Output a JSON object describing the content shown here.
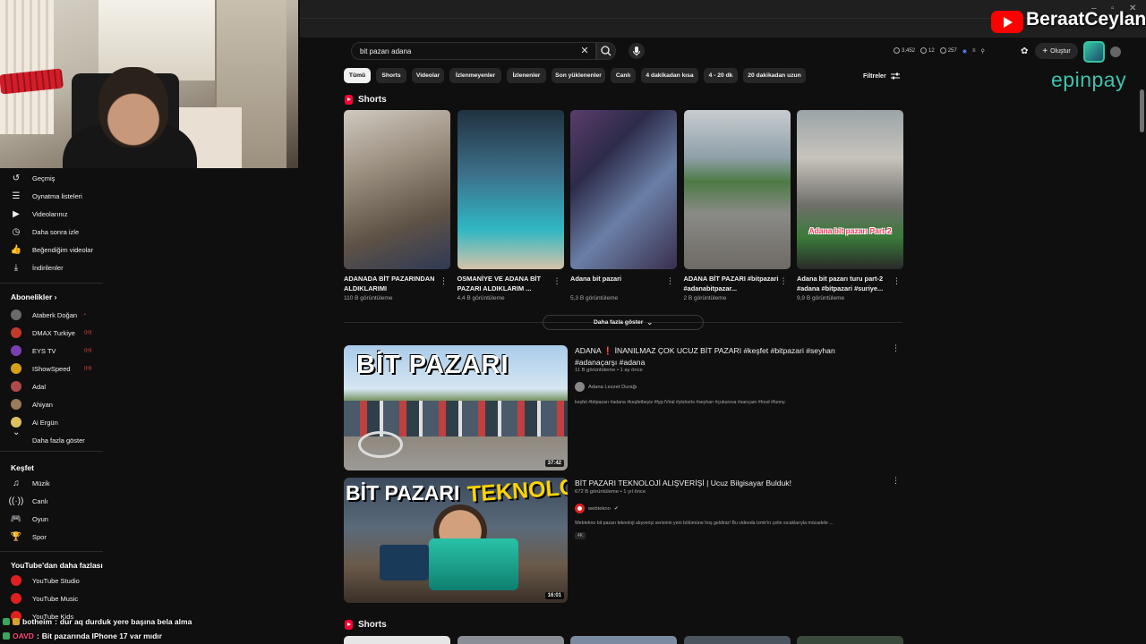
{
  "overlay": {
    "channel_name": "BeraatCeylan",
    "sponsor": "epinpay"
  },
  "search": {
    "query": "bit pazarı adana"
  },
  "header": {
    "stats": [
      "3,452",
      "12",
      "257"
    ],
    "create_label": "Oluştur"
  },
  "sidebar": {
    "you_items": [
      {
        "label": "Geçmiş",
        "icon": "history-icon"
      },
      {
        "label": "Oynatma listeleri",
        "icon": "playlist-icon"
      },
      {
        "label": "Videolarınız",
        "icon": "video-icon"
      },
      {
        "label": "Daha sonra izle",
        "icon": "clock-icon"
      },
      {
        "label": "Beğendiğim videolar",
        "icon": "thumbs-up-icon"
      },
      {
        "label": "İndirilenler",
        "icon": "download-icon"
      }
    ],
    "subscriptions_title": "Abonelikler",
    "subscriptions": [
      {
        "label": "Ataberk Doğan",
        "color": "#6a6a6a",
        "live": "•"
      },
      {
        "label": "DMAX Turkiye",
        "color": "#c0392b",
        "live": "((•))"
      },
      {
        "label": "EYS TV",
        "color": "#7b3fb3",
        "live": "((•))"
      },
      {
        "label": "IShowSpeed",
        "color": "#d4a017",
        "live": "((•))"
      },
      {
        "label": "Adal",
        "color": "#b04a4a",
        "live": ""
      },
      {
        "label": "Ahiyan",
        "color": "#9a7b5a",
        "live": ""
      },
      {
        "label": "Ai Ergün",
        "color": "#e0c060",
        "live": ""
      }
    ],
    "show_more": "Daha fazla göster",
    "explore_title": "Keşfet",
    "explore": [
      {
        "label": "Müzik",
        "icon": "music-icon"
      },
      {
        "label": "Canlı",
        "icon": "live-icon"
      },
      {
        "label": "Oyun",
        "icon": "gamepad-icon"
      },
      {
        "label": "Spor",
        "icon": "trophy-icon"
      }
    ],
    "more_title": "YouTube'dan daha fazlası",
    "more": [
      {
        "label": "YouTube Studio"
      },
      {
        "label": "YouTube Music"
      },
      {
        "label": "YouTube Kids"
      }
    ]
  },
  "chips": [
    "Tümü",
    "Shorts",
    "Videolar",
    "İzlenmeyenler",
    "İzlenenler",
    "Son yüklenenler",
    "Canlı",
    "4 dakikadan kısa",
    "4 - 20 dk",
    "20 dakikadan uzun"
  ],
  "filters_label": "Filtreler",
  "shorts_title": "Shorts",
  "shorts": [
    {
      "title": "ADANADA BİT PAZARINDAN ALDIKLARIMI",
      "views": "110 B görüntüleme",
      "overlay": ""
    },
    {
      "title": "OSMANİYE VE ADANA BİT PAZARI ALDIKLARIM ...",
      "views": "4,4 B görüntüleme",
      "overlay": ""
    },
    {
      "title": "Adana bit pazari",
      "views": "5,3 B görüntüleme",
      "overlay": ""
    },
    {
      "title": "ADANA BİT PAZARI #bitpazari #adanabitpazar...",
      "views": "2 B görüntüleme",
      "overlay": ""
    },
    {
      "title": "Adana bit pazarı turu part-2 #adana #bitpazari #suriye...",
      "views": "9,9 B görüntüleme",
      "overlay": "Adana bit pazarı Part-2"
    }
  ],
  "show_more_button": "Daha fazla göster",
  "videos": [
    {
      "title": "ADANA ❗️ İNANILMAZ ÇOK UCUZ BİT PAZARI #keşfet #bitpazari #seyhan #adanaçarşı #adana",
      "meta": "11 B görüntüleme • 1 ay önce",
      "channel": "Adana Lezzet Durağı",
      "description": "keşfet #bitpazarı #adana #keşfetbeyiz #fyp:/Viral #ytshorts #seyhan #çukurova #sarıçam #food #funny.",
      "duration": "37:42",
      "thumb_text": "BİT PAZARI"
    },
    {
      "title": "BİT PAZARI TEKNOLOJİ ALIŞVERİŞİ | Ucuz Bilgisayar Bulduk!",
      "meta": "672 B görüntüleme • 1 yıl önce",
      "channel": "webtekno",
      "description": "Webtekno bit pazarı teknoloji alışverişi serisinin yeni bölümüne hoş geldiniz! Bu videoda İzmir'in çetin sıcaklarıyla mücadele ...",
      "duration": "16:01",
      "badge": "4K",
      "thumb_text_a": "BİT PAZARI",
      "thumb_text_b": "TEKNOLOJİ"
    }
  ],
  "chat": [
    {
      "user": "botheim",
      "message": "dur aq durduk yere başına bela alma"
    },
    {
      "user": "OAVD",
      "message": "Bit pazarında IPhone 17 var mıdır"
    }
  ]
}
